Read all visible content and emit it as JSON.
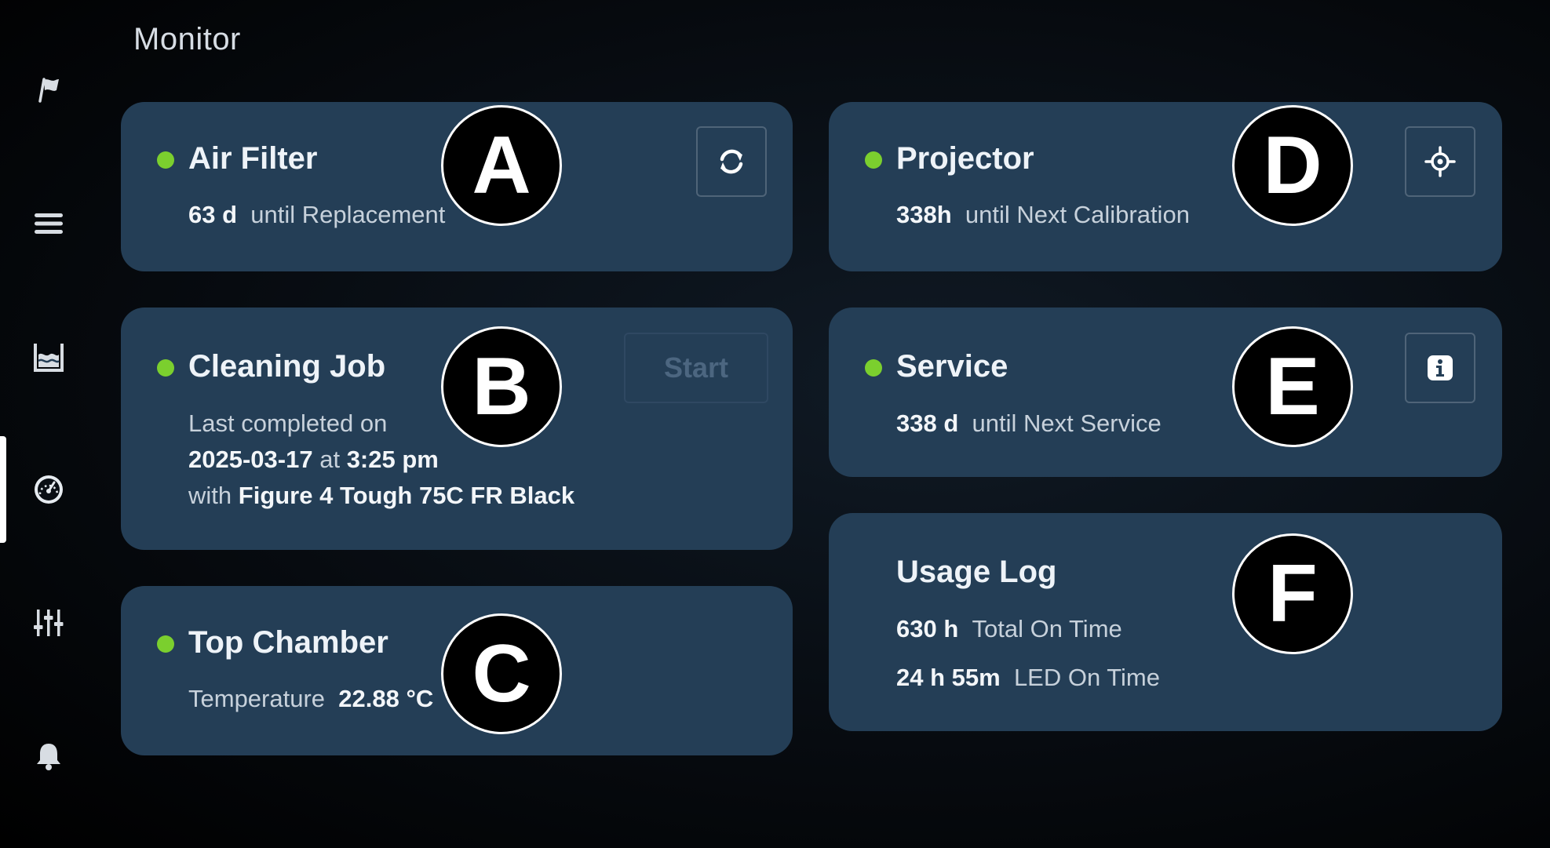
{
  "page": {
    "title": "Monitor"
  },
  "sidebar": {
    "items": [
      {
        "icon": "flag-icon",
        "active": false
      },
      {
        "icon": "menu-icon",
        "active": false
      },
      {
        "icon": "tank-icon",
        "active": false
      },
      {
        "icon": "gauge-icon",
        "active": true
      },
      {
        "icon": "sliders-icon",
        "active": false
      },
      {
        "icon": "bell-icon",
        "active": false
      }
    ]
  },
  "cards": {
    "air_filter": {
      "title": "Air Filter",
      "value": "63 d",
      "label": "until Replacement",
      "action_icon": "refresh-icon",
      "status_color": "#7bcf2e"
    },
    "cleaning_job": {
      "title": "Cleaning Job",
      "line1": "Last completed on",
      "date": "2025-03-17",
      "at": "at",
      "time": "3:25 pm",
      "with": "with",
      "material": "Figure 4 Tough 75C FR Black",
      "start_label": "Start",
      "status_color": "#7bcf2e"
    },
    "top_chamber": {
      "title": "Top Chamber",
      "label": "Temperature",
      "value": "22.88 °C",
      "status_color": "#7bcf2e"
    },
    "projector": {
      "title": "Projector",
      "value": "338h",
      "label": "until Next Calibration",
      "action_icon": "crosshair-icon",
      "status_color": "#7bcf2e"
    },
    "service": {
      "title": "Service",
      "value": "338 d",
      "label": "until Next Service",
      "action_icon": "info-icon",
      "status_color": "#7bcf2e"
    },
    "usage_log": {
      "title": "Usage Log",
      "total_value": "630 h",
      "total_label": "Total On Time",
      "led_value": "24 h 55m",
      "led_label": "LED On Time"
    }
  },
  "markers": [
    "A",
    "B",
    "C",
    "D",
    "E",
    "F"
  ]
}
